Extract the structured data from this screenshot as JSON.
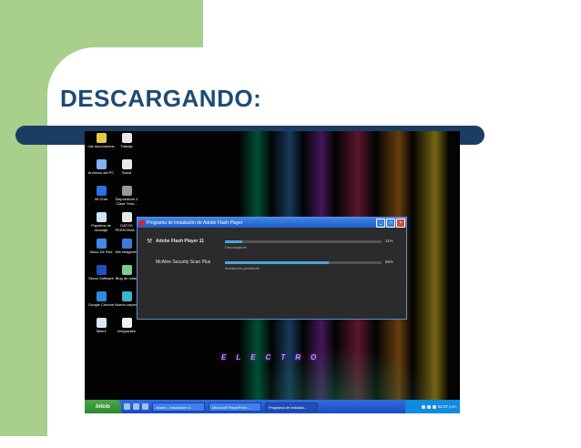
{
  "slide": {
    "title": "DESCARGANDO:"
  },
  "desktop": {
    "icons": [
      {
        "label": "mis documentos",
        "color": "#e8c94a"
      },
      {
        "label": "Trabajo",
        "color": "#e8e8e8"
      },
      {
        "label": "Archivos del PC",
        "color": "#7fb2ef"
      },
      {
        "label": "Salud",
        "color": "#e8e8e8"
      },
      {
        "label": "Mi Chat",
        "color": "#2f6fe0"
      },
      {
        "label": "Dispositivos 2 Clase Yves...",
        "color": "#9a9a9a"
      },
      {
        "label": "Papelera de reciclaje",
        "color": "#cfe3f7"
      },
      {
        "label": "DATOS PERSONAL...",
        "color": "#e8e8e8"
      },
      {
        "label": "Disco De Red",
        "color": "#3f8ae6"
      },
      {
        "label": "Mis imagenes",
        "color": "#3d7ad8"
      },
      {
        "label": "Seccs Software",
        "color": "#1f4fc0"
      },
      {
        "label": "Blog de notas",
        "color": "#7ccf8a"
      },
      {
        "label": "Google Chrome",
        "color": "#2f8ae0"
      },
      {
        "label": "Nueva carpeta",
        "color": "#3fb0d0"
      },
      {
        "label": "Taller1",
        "color": "#d9e6f7"
      },
      {
        "label": "integrantes",
        "color": "#f2f2f2"
      }
    ],
    "wallpaper_text": "ELECTRO"
  },
  "dialog": {
    "title": "Programa de instalación de Adobe Flash Player",
    "items": [
      {
        "name": "Adobe Flash Player 11",
        "status": "Descargando",
        "percent_text": "11%",
        "progress": 11
      },
      {
        "name": "McAfee Security Scan Plus",
        "status": "Instalación pendiente",
        "percent_text": "66%",
        "progress": 66
      }
    ]
  },
  "taskbar": {
    "start_label": "Inicio",
    "tasks": [
      {
        "label": "Adobe - Instalación d..."
      },
      {
        "label": "Microsoft PowerPoint ..."
      },
      {
        "label": "Programa de instalaci..."
      }
    ],
    "clock": "02:07 p.m."
  }
}
